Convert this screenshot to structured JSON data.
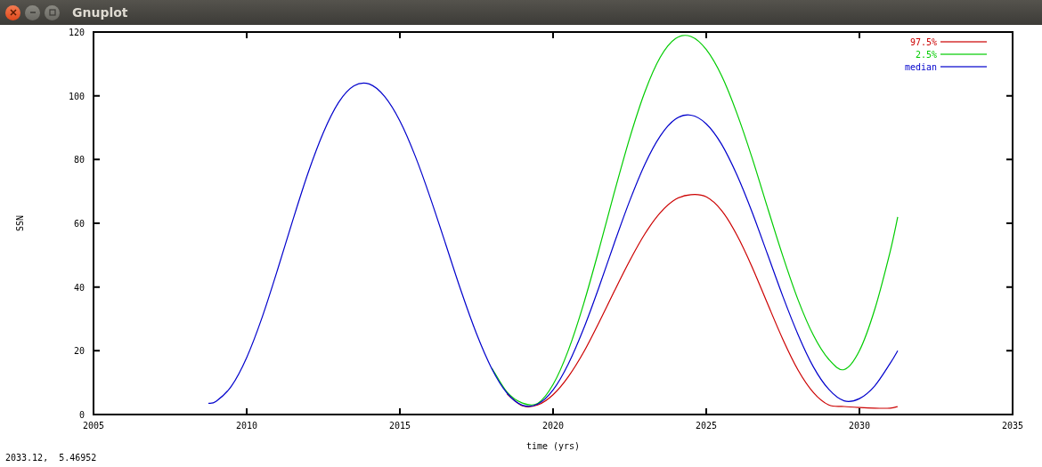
{
  "window": {
    "title": "Gnuplot"
  },
  "plot": {
    "chart_data": {
      "type": "line",
      "xlabel": "time (yrs)",
      "ylabel": "SSN",
      "xlim": [
        2005,
        2035
      ],
      "ylim": [
        0,
        120
      ],
      "xticks": [
        2005,
        2010,
        2015,
        2020,
        2025,
        2030,
        2035
      ],
      "yticks": [
        0,
        20,
        40,
        60,
        80,
        100,
        120
      ],
      "x": [
        2008.75,
        2009,
        2009.5,
        2010,
        2010.5,
        2011,
        2011.5,
        2012,
        2012.5,
        2013,
        2013.5,
        2014,
        2014.5,
        2015,
        2015.5,
        2016,
        2016.5,
        2017,
        2017.5,
        2018,
        2018.5,
        2019,
        2019.5,
        2020,
        2020.5,
        2021,
        2021.5,
        2022,
        2022.5,
        2023,
        2023.5,
        2024,
        2024.5,
        2025,
        2025.5,
        2026,
        2026.5,
        2027,
        2027.5,
        2028,
        2028.5,
        2029,
        2029.5,
        2030,
        2030.5,
        2031,
        2031.25
      ],
      "series": [
        {
          "name": "97.5%",
          "color": "#cc0000",
          "values": [
            null,
            null,
            null,
            null,
            null,
            null,
            null,
            null,
            null,
            null,
            null,
            null,
            null,
            null,
            null,
            null,
            null,
            null,
            null,
            null,
            6.4,
            2.7,
            3.0,
            6.2,
            11.9,
            19.6,
            28.9,
            38.7,
            48.2,
            56.7,
            63.3,
            67.5,
            69,
            68.3,
            64,
            56.3,
            46.2,
            34.8,
            23.6,
            13.9,
            6.9,
            3,
            2.5,
            2.2,
            2,
            2,
            2.5
          ]
        },
        {
          "name": "2.5%",
          "color": "#00cc00",
          "values": [
            null,
            null,
            null,
            null,
            null,
            null,
            null,
            null,
            null,
            null,
            null,
            null,
            null,
            null,
            null,
            null,
            null,
            null,
            null,
            14.6,
            7.0,
            3.6,
            3.5,
            9.4,
            20.2,
            34.8,
            51.8,
            69.7,
            86.7,
            101.3,
            112.1,
            118,
            118.6,
            114.5,
            106.3,
            94.5,
            80.4,
            64.9,
            49.7,
            35.9,
            24.8,
            17.3,
            14.1,
            20,
            33,
            51,
            62
          ]
        },
        {
          "name": "median",
          "color": "#0000cc",
          "values": [
            3.5,
            4.1,
            8.9,
            17.9,
            30.4,
            45.2,
            60.8,
            75.7,
            88.4,
            97.9,
            103.1,
            103.7,
            99.8,
            92.1,
            81.1,
            67.8,
            53.3,
            38.7,
            25.4,
            14.4,
            6.7,
            2.9,
            3.3,
            7.7,
            15.9,
            27.0,
            40.0,
            53.8,
            67.0,
            78.6,
            87.4,
            92.7,
            93.9,
            91.2,
            84.8,
            75.2,
            63.4,
            50.3,
            37.1,
            25,
            14.9,
            7.9,
            4.3,
            5,
            9,
            16,
            20
          ]
        }
      ]
    }
  },
  "status_bar": {
    "text": "2033.12,  5.46952"
  }
}
